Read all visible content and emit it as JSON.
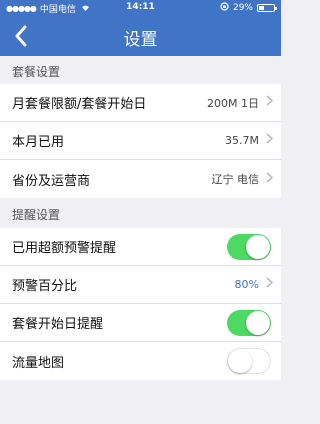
{
  "status_bar": {
    "carrier": "中国电信",
    "time": "14:11",
    "battery": "29%",
    "battery_level": 0.29
  },
  "nav": {
    "back_icon": "chevron-left-icon",
    "title": "设置"
  },
  "sections": {
    "plan": {
      "label": "套餐设置",
      "rows": [
        {
          "label": "月套餐限额/套餐开始日",
          "value": "200M 1日"
        },
        {
          "label": "本月已用",
          "value": "35.7M"
        },
        {
          "label": "省份及运营商",
          "value": "辽宁 电信"
        }
      ]
    },
    "alert": {
      "label": "提醒设置",
      "rows": [
        {
          "label": "已用超额预警提醒",
          "toggle": true
        },
        {
          "label": "预警百分比",
          "value": "80%"
        },
        {
          "label": "套餐开始日提醒",
          "toggle": true
        },
        {
          "label": "流量地图",
          "toggle": false
        }
      ]
    }
  },
  "colors": {
    "header": "#3f74c6",
    "toggle_on": "#4cd964",
    "accent_value": "#3f74c6"
  }
}
